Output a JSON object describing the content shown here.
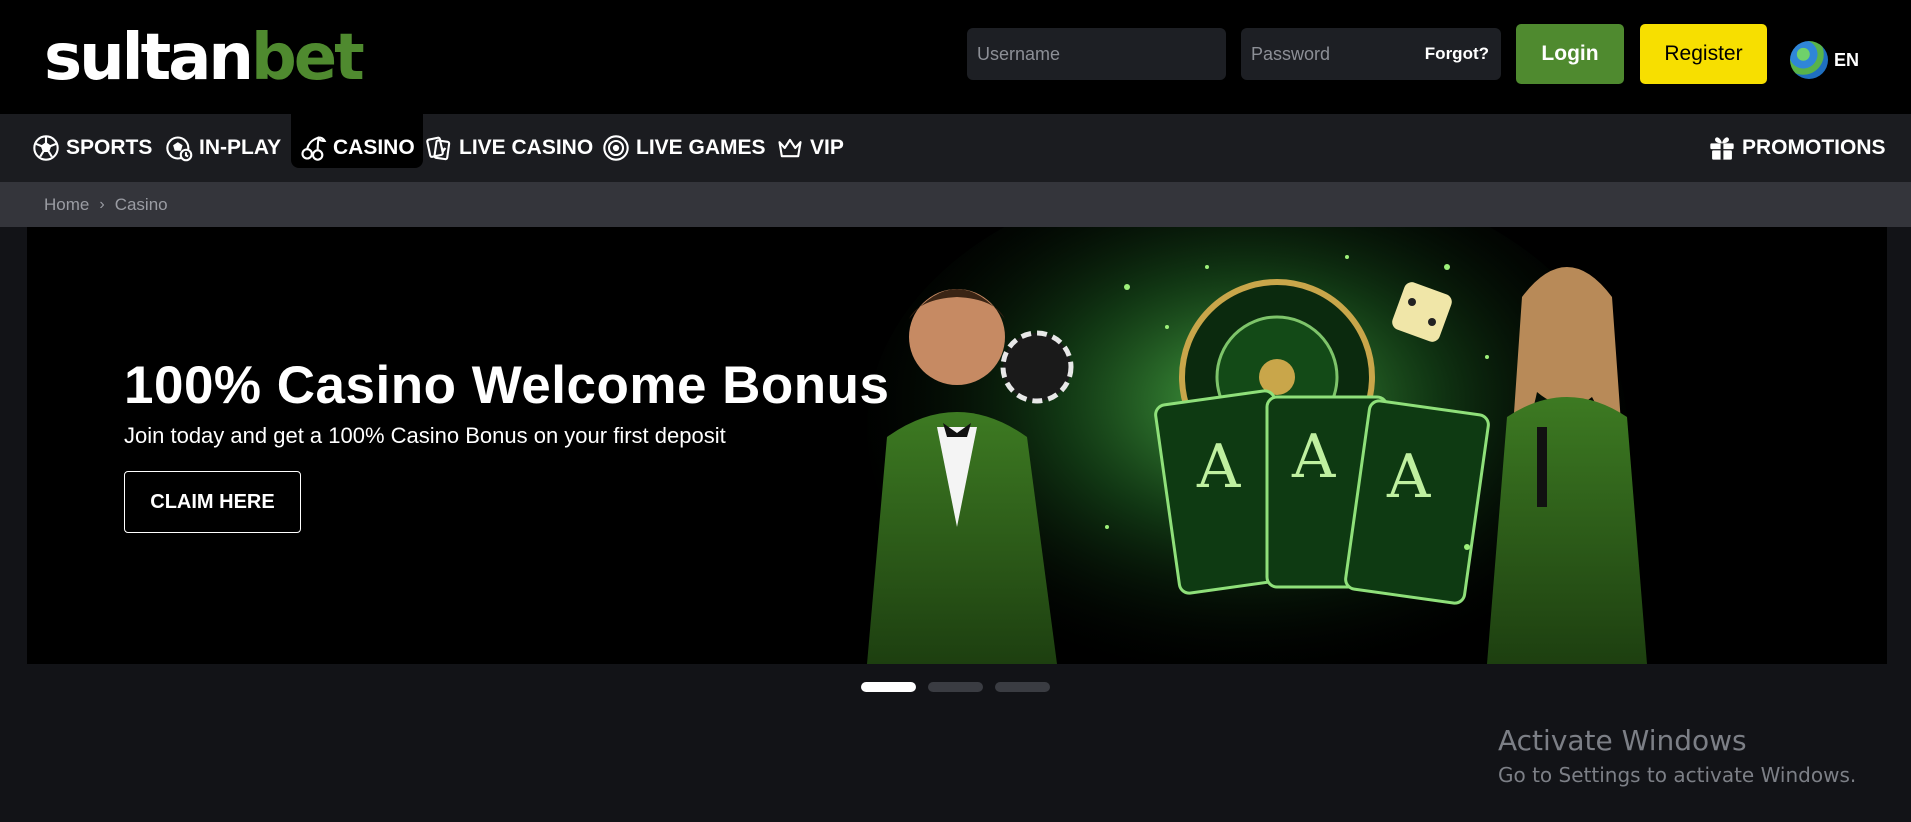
{
  "header": {
    "logo": {
      "part1": "sultan",
      "part2": "bet"
    },
    "username_placeholder": "Username",
    "password_placeholder": "Password",
    "forgot_label": "Forgot?",
    "login_label": "Login",
    "register_label": "Register",
    "language": "EN"
  },
  "nav": {
    "items": [
      {
        "label": "SPORTS",
        "icon": "soccer-ball-icon"
      },
      {
        "label": "IN-PLAY",
        "icon": "live-ball-icon"
      },
      {
        "label": "CASINO",
        "icon": "cherry-icon",
        "active": true
      },
      {
        "label": "LIVE CASINO",
        "icon": "cards-icon"
      },
      {
        "label": "LIVE GAMES",
        "icon": "wheel-icon"
      },
      {
        "label": "VIP",
        "icon": "crown-icon"
      }
    ],
    "promotions": {
      "label": "PROMOTIONS",
      "icon": "gift-icon"
    }
  },
  "breadcrumb": {
    "home": "Home",
    "current": "Casino"
  },
  "banner": {
    "title": "100% Casino Welcome Bonus",
    "subtitle": "Join today and get a 100% Casino Bonus on your first deposit",
    "cta": "CLAIM HERE"
  },
  "carousel": {
    "slide_count": 3,
    "active_index": 0
  },
  "watermark": {
    "title": "Activate Windows",
    "subtitle": "Go to Settings to activate Windows."
  },
  "colors": {
    "brand_green": "#4f8a2f",
    "register_yellow": "#f7df00",
    "header_bg": "#000000",
    "nav_bg": "#1b1c20",
    "breadcrumb_bg": "#34353b",
    "page_bg": "#121317"
  }
}
